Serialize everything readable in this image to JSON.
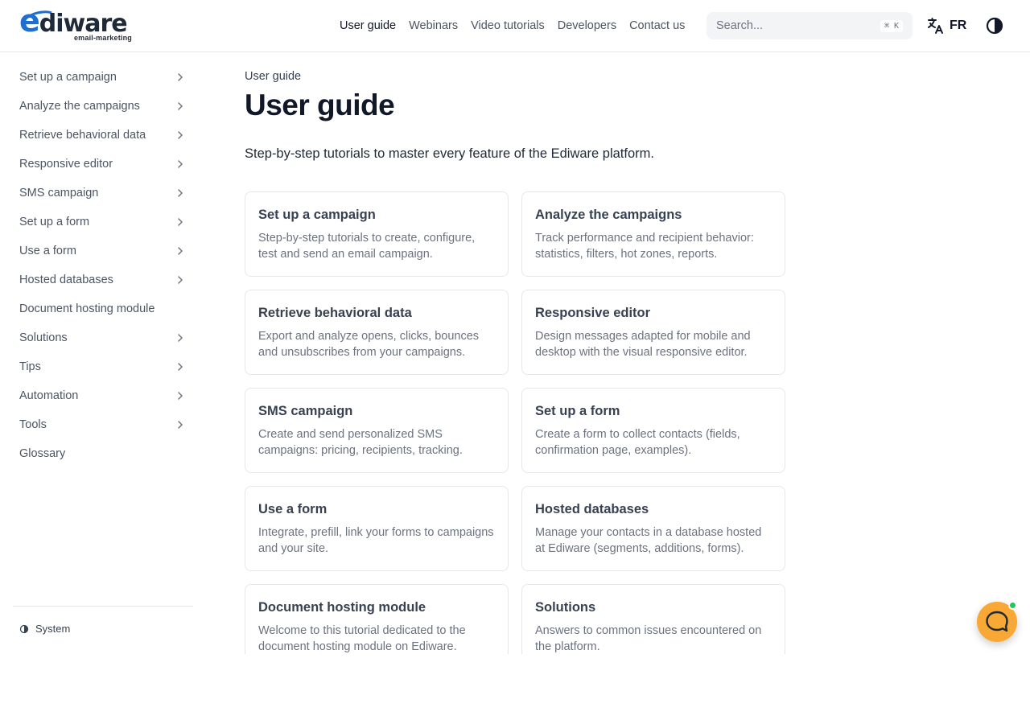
{
  "brand": {
    "name": "diware",
    "initial": "e",
    "tagline": "email-marketing",
    "accent": "#1d6fd1"
  },
  "topnav": {
    "items": [
      {
        "label": "User guide",
        "active": true
      },
      {
        "label": "Webinars",
        "active": false
      },
      {
        "label": "Video tutorials",
        "active": false
      },
      {
        "label": "Developers",
        "active": false
      },
      {
        "label": "Contact us",
        "active": false
      }
    ]
  },
  "search": {
    "placeholder": "Search...",
    "shortcut": "⌘ K"
  },
  "language": {
    "label": "FR",
    "icon": "translate-icon"
  },
  "theme_toggle": {
    "icon": "contrast-icon"
  },
  "sidebar": {
    "items": [
      {
        "label": "Set up a campaign",
        "expandable": true
      },
      {
        "label": "Analyze the campaigns",
        "expandable": true
      },
      {
        "label": "Retrieve behavioral data",
        "expandable": true
      },
      {
        "label": "Responsive editor",
        "expandable": true
      },
      {
        "label": "SMS campaign",
        "expandable": true
      },
      {
        "label": "Set up a form",
        "expandable": true
      },
      {
        "label": "Use a form",
        "expandable": true
      },
      {
        "label": "Hosted databases",
        "expandable": true
      },
      {
        "label": "Document hosting module",
        "expandable": false
      },
      {
        "label": "Solutions",
        "expandable": true
      },
      {
        "label": "Tips",
        "expandable": true
      },
      {
        "label": "Automation",
        "expandable": true
      },
      {
        "label": "Tools",
        "expandable": true
      },
      {
        "label": "Glossary",
        "expandable": false
      }
    ],
    "theme_mode": "System"
  },
  "main": {
    "breadcrumb": "User guide",
    "title": "User guide",
    "description": "Step-by-step tutorials to master every feature of the Ediware platform.",
    "cards": [
      {
        "title": "Set up a campaign",
        "description": "Step-by-step tutorials to create, configure, test and send an email campaign."
      },
      {
        "title": "Analyze the campaigns",
        "description": "Track performance and recipient behavior: statistics, filters, hot zones, reports."
      },
      {
        "title": "Retrieve behavioral data",
        "description": "Export and analyze opens, clicks, bounces and unsubscribes from your campaigns."
      },
      {
        "title": "Responsive editor",
        "description": "Design messages adapted for mobile and desktop with the visual responsive editor."
      },
      {
        "title": "SMS campaign",
        "description": "Create and send personalized SMS campaigns: pricing, recipients, tracking."
      },
      {
        "title": "Set up a form",
        "description": "Create a form to collect contacts (fields, confirmation page, examples)."
      },
      {
        "title": "Use a form",
        "description": "Integrate, prefill, link your forms to campaigns and your site."
      },
      {
        "title": "Hosted databases",
        "description": "Manage your contacts in a database hosted at Ediware (segments, additions, forms)."
      },
      {
        "title": "Document hosting module",
        "description": "Welcome to this tutorial dedicated to the document hosting module on Ediware."
      },
      {
        "title": "Solutions",
        "description": "Answers to common issues encountered on the platform."
      }
    ]
  },
  "chat": {
    "icon": "chat-bubble-icon",
    "color": "#f8a834",
    "status_color": "#22c55e"
  }
}
